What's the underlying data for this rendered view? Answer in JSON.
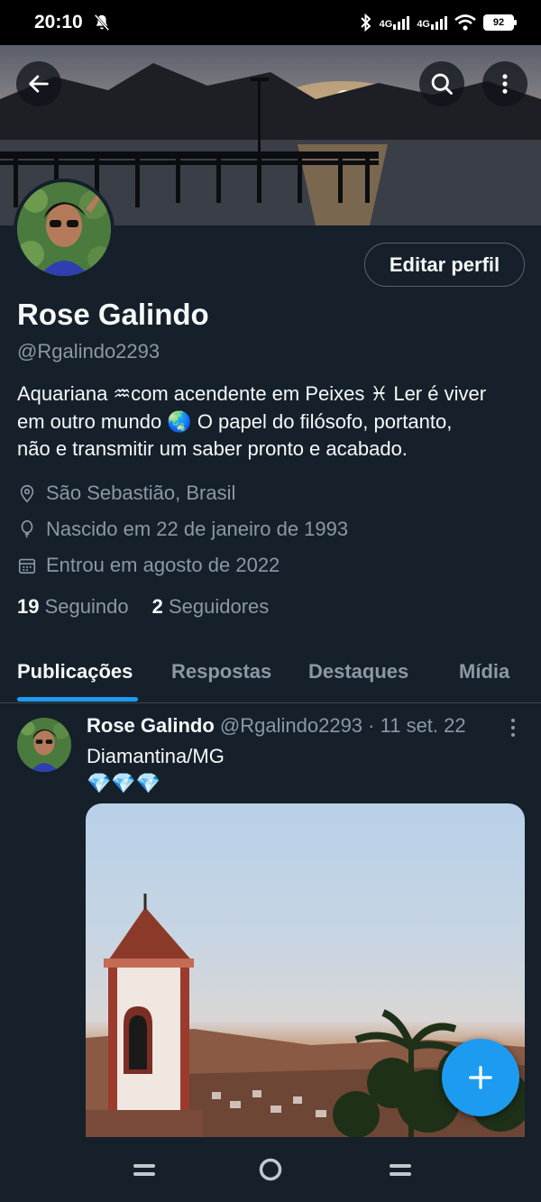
{
  "status_bar": {
    "time": "20:10",
    "signal_1": "4G",
    "signal_2": "4G",
    "battery": "92",
    "icons": [
      "mute-icon",
      "bluetooth-icon",
      "signal-icon",
      "wifi-icon",
      "battery-icon"
    ]
  },
  "header": {
    "back_icon": "arrow-left-icon",
    "search_icon": "search-icon",
    "more_icon": "more-vertical-icon"
  },
  "profile": {
    "edit_button": "Editar perfil",
    "name": "Rose Galindo",
    "handle": "@Rgalindo2293",
    "bio_line1": "Aquariana ♒com acendente em Peixes ♓ Ler é viver",
    "bio_line2": "em outro mundo 🌏  O papel do filósofo, portanto,",
    "bio_line3": "não e transmitir um saber pronto e acabado.",
    "location": "São Sebastião, Brasil",
    "birthday": "Nascido em 22 de janeiro de 1993",
    "joined": "Entrou em agosto de 2022",
    "following_count": "19",
    "following_label": "Seguindo",
    "followers_count": "2",
    "followers_label": "Seguidores"
  },
  "tabs": [
    {
      "label": "Publicações",
      "active": true
    },
    {
      "label": "Respostas",
      "active": false
    },
    {
      "label": "Destaques",
      "active": false
    },
    {
      "label": "Mídia",
      "active": false
    }
  ],
  "post": {
    "author": "Rose Galindo",
    "handle": "@Rgalindo2293",
    "separator": "·",
    "date": "11 set. 22",
    "text_line1": "Diamantina/MG",
    "text_line2": "💎💎💎"
  },
  "colors": {
    "background": "#15202b",
    "accent": "#1d9bf0",
    "secondary_text": "#8b98a5",
    "border": "#38444d"
  }
}
